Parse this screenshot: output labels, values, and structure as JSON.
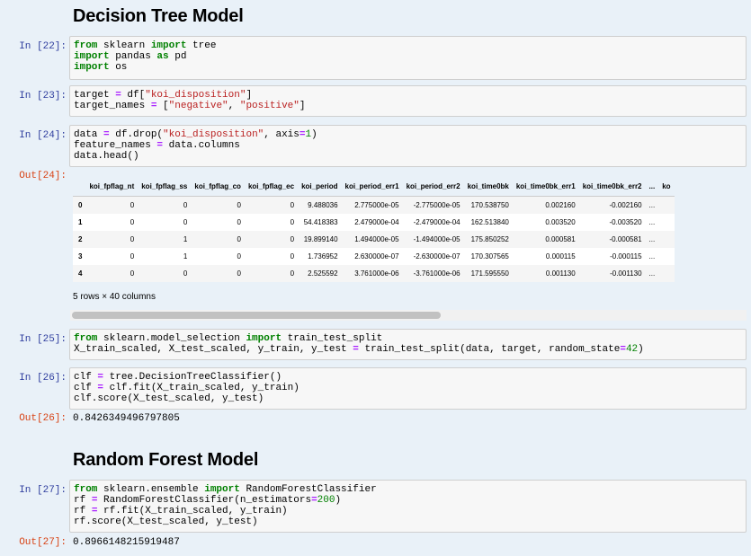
{
  "headings": {
    "decision_tree": "Decision Tree Model",
    "random_forest": "Random Forest Model"
  },
  "cells": [
    {
      "prompt": "In [22]:"
    },
    {
      "prompt": "In [23]:"
    },
    {
      "prompt": "In [24]:",
      "out_prompt": "Out[24]:"
    },
    {
      "prompt": "In [25]:"
    },
    {
      "prompt": "In [26]:",
      "out_prompt": "Out[26]:",
      "output": "0.8426349496797805"
    },
    {
      "prompt": "In [27]:",
      "out_prompt": "Out[27]:",
      "output": "0.8966148215919487"
    }
  ],
  "code": {
    "c22": [
      "from sklearn import tree",
      "import pandas as pd",
      "import os"
    ],
    "c23": [
      "target = df[\"koi_disposition\"]",
      "target_names = [\"negative\", \"positive\"]"
    ],
    "c24": [
      "data = df.drop(\"koi_disposition\", axis=1)",
      "feature_names = data.columns",
      "data.head()"
    ],
    "c25": [
      "from sklearn.model_selection import train_test_split",
      "X_train_scaled, X_test_scaled, y_train, y_test = train_test_split(data, target, random_state=42)"
    ],
    "c26": [
      "clf = tree.DecisionTreeClassifier()",
      "clf = clf.fit(X_train_scaled, y_train)",
      "clf.score(X_test_scaled, y_test)"
    ],
    "c27": [
      "from sklearn.ensemble import RandomForestClassifier",
      "rf = RandomForestClassifier(n_estimators=200)",
      "rf = rf.fit(X_train_scaled, y_train)",
      "rf.score(X_test_scaled, y_test)"
    ]
  },
  "dataframe": {
    "columns": [
      "",
      "koi_fpflag_nt",
      "koi_fpflag_ss",
      "koi_fpflag_co",
      "koi_fpflag_ec",
      "koi_period",
      "koi_period_err1",
      "koi_period_err2",
      "koi_time0bk",
      "koi_time0bk_err1",
      "koi_time0bk_err2",
      "...",
      "ko"
    ],
    "rows": [
      [
        "0",
        "0",
        "0",
        "0",
        "0",
        "9.488036",
        "2.775000e-05",
        "-2.775000e-05",
        "170.538750",
        "0.002160",
        "-0.002160",
        "...",
        ""
      ],
      [
        "1",
        "0",
        "0",
        "0",
        "0",
        "54.418383",
        "2.479000e-04",
        "-2.479000e-04",
        "162.513840",
        "0.003520",
        "-0.003520",
        "...",
        ""
      ],
      [
        "2",
        "0",
        "1",
        "0",
        "0",
        "19.899140",
        "1.494000e-05",
        "-1.494000e-05",
        "175.850252",
        "0.000581",
        "-0.000581",
        "...",
        ""
      ],
      [
        "3",
        "0",
        "1",
        "0",
        "0",
        "1.736952",
        "2.630000e-07",
        "-2.630000e-07",
        "170.307565",
        "0.000115",
        "-0.000115",
        "...",
        ""
      ],
      [
        "4",
        "0",
        "0",
        "0",
        "0",
        "2.525592",
        "3.761000e-06",
        "-3.761000e-06",
        "171.595550",
        "0.001130",
        "-0.001130",
        "...",
        ""
      ]
    ],
    "summary": "5 rows × 40 columns"
  }
}
